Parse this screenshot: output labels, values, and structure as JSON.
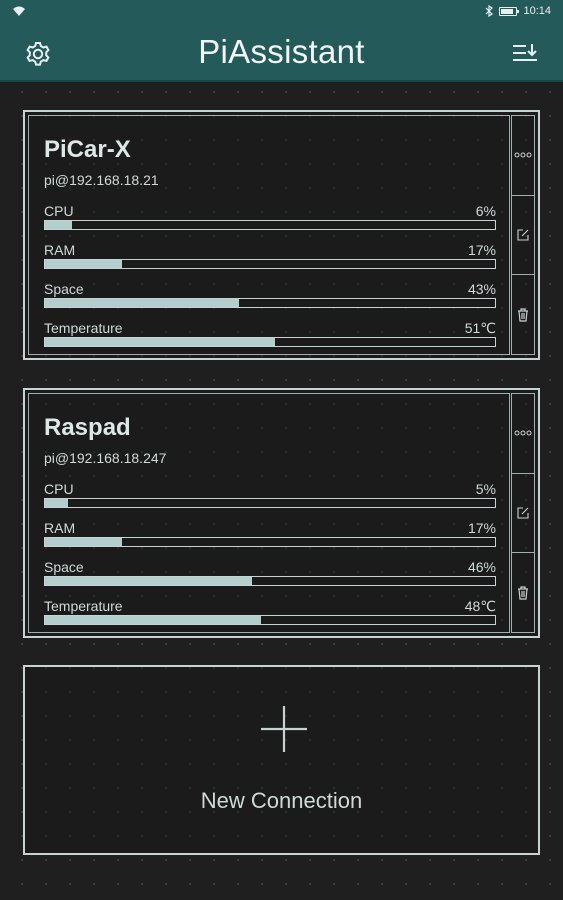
{
  "status": {
    "time": "10:14"
  },
  "app": {
    "title": "PiAssistant"
  },
  "devices": [
    {
      "name": "PiCar-X",
      "host": "pi@192.168.18.21",
      "metrics": [
        {
          "label": "CPU",
          "value": "6%",
          "fraction": 0.06
        },
        {
          "label": "RAM",
          "value": "17%",
          "fraction": 0.17
        },
        {
          "label": "Space",
          "value": "43%",
          "fraction": 0.43
        },
        {
          "label": "Temperature",
          "value": "51℃",
          "fraction": 0.51
        }
      ]
    },
    {
      "name": "Raspad",
      "host": "pi@192.168.18.247",
      "metrics": [
        {
          "label": "CPU",
          "value": "5%",
          "fraction": 0.05
        },
        {
          "label": "RAM",
          "value": "17%",
          "fraction": 0.17
        },
        {
          "label": "Space",
          "value": "46%",
          "fraction": 0.46
        },
        {
          "label": "Temperature",
          "value": "48℃",
          "fraction": 0.48
        }
      ]
    }
  ],
  "new_connection": {
    "label": "New Connection"
  },
  "icons": {
    "settings": "gear-icon",
    "sort": "sort-icon",
    "more": "more-icon",
    "edit": "edit-icon",
    "delete": "trash-icon",
    "add": "plus-icon"
  },
  "colors": {
    "appbar": "#245b5a",
    "accent": "#b2cfce",
    "background": "#1f1f1f"
  }
}
